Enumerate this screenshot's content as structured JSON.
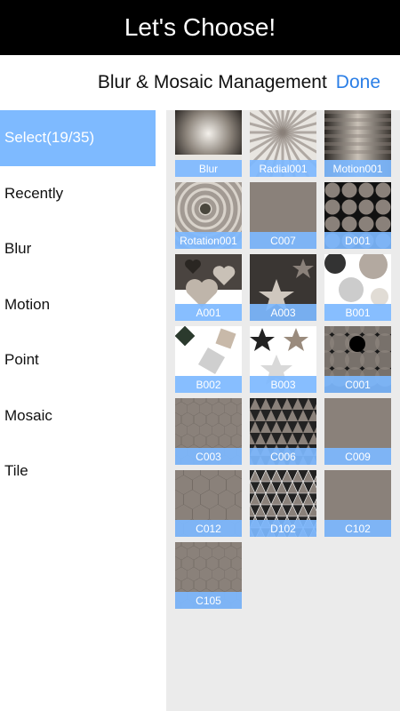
{
  "app": {
    "title": "Let's Choose!"
  },
  "header": {
    "title": "Blur & Mosaic Management",
    "done_label": "Done"
  },
  "sidebar": {
    "items": [
      {
        "label": "Select(19/35)",
        "active": true
      },
      {
        "label": "Recently"
      },
      {
        "label": "Blur"
      },
      {
        "label": "Motion"
      },
      {
        "label": "Point"
      },
      {
        "label": "Mosaic"
      },
      {
        "label": "Tile"
      }
    ]
  },
  "tiles": [
    {
      "label": "Blur",
      "kind": "blur"
    },
    {
      "label": "Radial001",
      "kind": "radial"
    },
    {
      "label": "Motion001",
      "kind": "motion"
    },
    {
      "label": "Rotation001",
      "kind": "rotation"
    },
    {
      "label": "C007",
      "kind": "squares"
    },
    {
      "label": "D001",
      "kind": "dots"
    },
    {
      "label": "A001",
      "kind": "hearts"
    },
    {
      "label": "A003",
      "kind": "stars"
    },
    {
      "label": "B001",
      "kind": "circles"
    },
    {
      "label": "B002",
      "kind": "diamonds"
    },
    {
      "label": "B003",
      "kind": "starsbig"
    },
    {
      "label": "C001",
      "kind": "circlegrid"
    },
    {
      "label": "C003",
      "kind": "hexsmall"
    },
    {
      "label": "C006",
      "kind": "triangles"
    },
    {
      "label": "C009",
      "kind": "trisquare"
    },
    {
      "label": "C012",
      "kind": "hexbig"
    },
    {
      "label": "D102",
      "kind": "trimesh"
    },
    {
      "label": "C102",
      "kind": "blocks"
    },
    {
      "label": "C105",
      "kind": "hexmix"
    }
  ],
  "colors": {
    "accent": "#7ebaff",
    "done": "#2a7ee6",
    "titlebar": "#000000"
  }
}
